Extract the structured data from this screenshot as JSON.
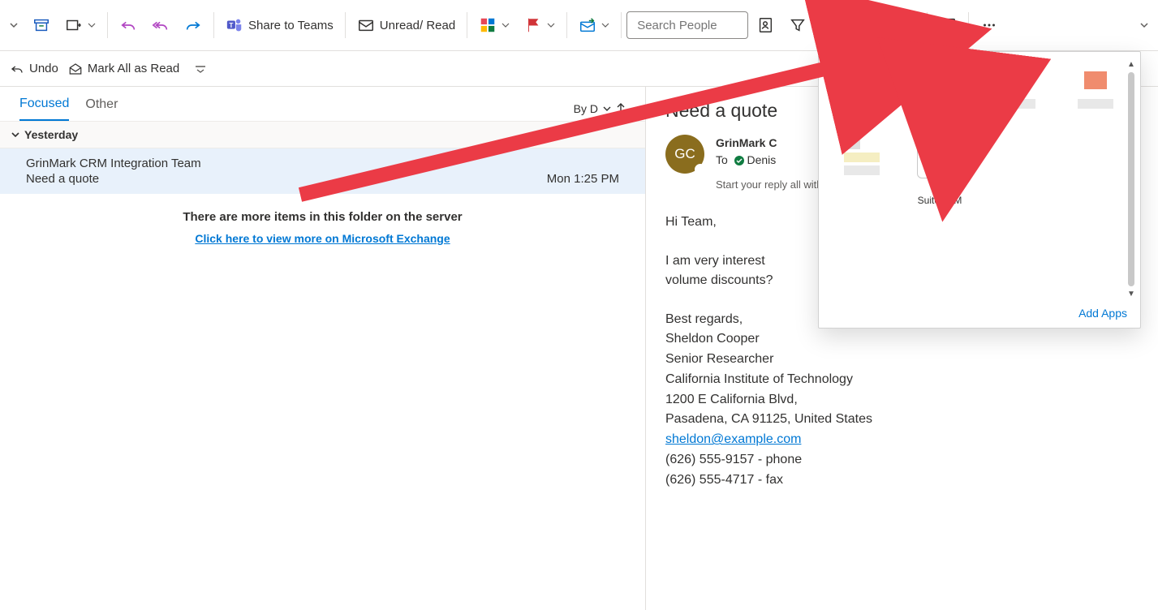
{
  "ribbon": {
    "share_teams": "Share to Teams",
    "unread_read": "Unread/ Read",
    "search_placeholder": "Search People"
  },
  "subbar": {
    "undo": "Undo",
    "mark_read": "Mark All as Read"
  },
  "tabs": {
    "focused": "Focused",
    "other": "Other",
    "sort_label": "By D"
  },
  "group": "Yesterday",
  "message": {
    "from": "GrinMark CRM Integration Team",
    "subject_short": "Need a quote",
    "time": "Mon 1:25 PM"
  },
  "more": {
    "line1": "There are more items in this folder on the server",
    "link": "Click here to view more on Microsoft Exchange"
  },
  "read": {
    "subject": "Need a quote",
    "avatar": "GC",
    "sender": "GrinMark C",
    "to_label": "To",
    "to_name": "Denis",
    "reply_hint": "Start your reply all with",
    "body_greeting": "Hi Team,",
    "body_line1": "I am very interest",
    "body_line2": "volume discounts?",
    "sig_regards": "Best regards,",
    "sig_name": "Sheldon Cooper",
    "sig_title": "Senior Researcher",
    "sig_org": "California Institute of Technology",
    "sig_addr1": "1200 E California Blvd,",
    "sig_addr2": "Pasadena, CA 91125, United States",
    "sig_email": "sheldon@example.com",
    "sig_phone": "(626) 555-9157 - phone",
    "sig_fax": "(626) 555-4717 - fax"
  },
  "apps": {
    "suite_label1": "<>",
    "suite_label2": "SuiteCRM",
    "add_apps": "Add Apps"
  }
}
